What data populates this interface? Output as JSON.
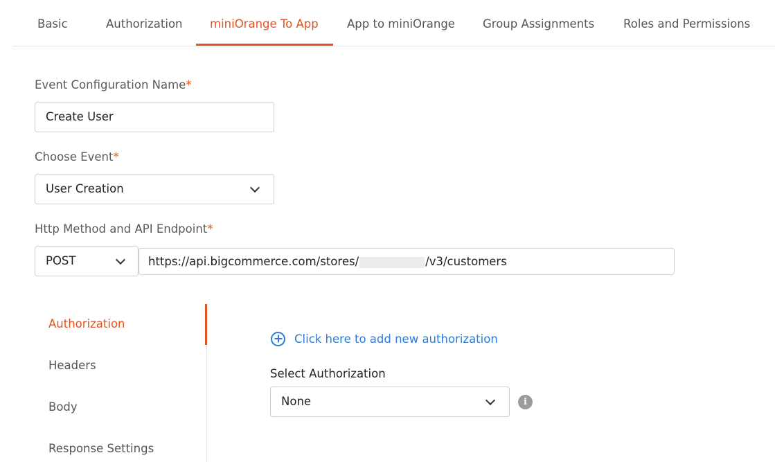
{
  "tabs": [
    {
      "label": "Basic"
    },
    {
      "label": "Authorization"
    },
    {
      "label": "miniOrange To App"
    },
    {
      "label": "App to miniOrange"
    },
    {
      "label": "Group Assignments"
    },
    {
      "label": "Roles and Permissions"
    }
  ],
  "active_tab": "miniOrange To App",
  "form": {
    "event_name_label": "Event Configuration Name",
    "event_name_value": "Create User",
    "choose_event_label": "Choose Event",
    "choose_event_value": "User Creation",
    "http_label": "Http Method and API Endpoint",
    "http_method": "POST",
    "endpoint_prefix": "https://api.bigcommerce.com/stores/",
    "endpoint_suffix": "/v3/customers",
    "required_mark": "*"
  },
  "vnav": [
    {
      "label": "Authorization"
    },
    {
      "label": "Headers"
    },
    {
      "label": "Body"
    },
    {
      "label": "Response Settings"
    }
  ],
  "auth_panel": {
    "add_link": "Click here to add new authorization",
    "select_label": "Select Authorization",
    "select_value": "None",
    "info_glyph": "i"
  },
  "colors": {
    "accent": "#e0531f",
    "link": "#2d7bd6"
  },
  "icons": {
    "dropdown": "chevron-down-icon",
    "add": "plus-circle-icon",
    "info": "info-icon"
  }
}
